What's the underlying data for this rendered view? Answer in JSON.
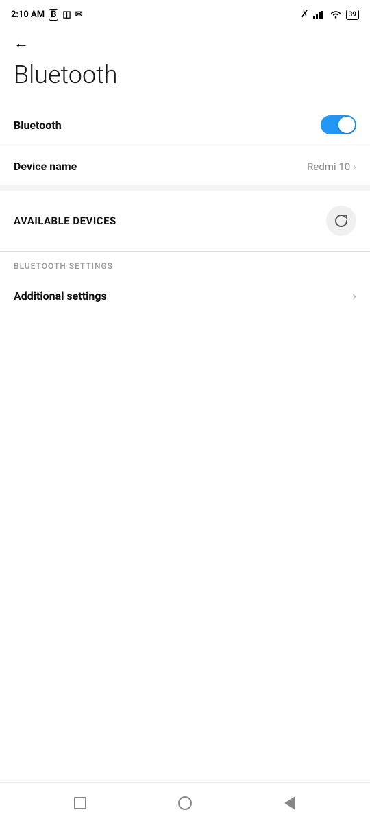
{
  "statusBar": {
    "time": "2:10 AM",
    "icons": [
      "B",
      "sim-card",
      "email"
    ],
    "rightIcons": [
      "bluetooth",
      "signal",
      "wifi",
      "battery"
    ],
    "batteryLevel": "39"
  },
  "header": {
    "backLabel": "←",
    "pageTitle": "Bluetooth"
  },
  "toggleRow": {
    "label": "Bluetooth",
    "toggleState": true
  },
  "deviceNameRow": {
    "label": "Device name",
    "value": "Redmi 10"
  },
  "availableDevices": {
    "sectionTitle": "AVAILABLE DEVICES",
    "refreshTitle": "Refresh"
  },
  "bluetoothSettings": {
    "sectionLabel": "BLUETOOTH SETTINGS",
    "additionalSettings": "Additional settings"
  },
  "bottomNav": {
    "squareLabel": "Recent apps",
    "circleLabel": "Home",
    "triangleLabel": "Back"
  }
}
